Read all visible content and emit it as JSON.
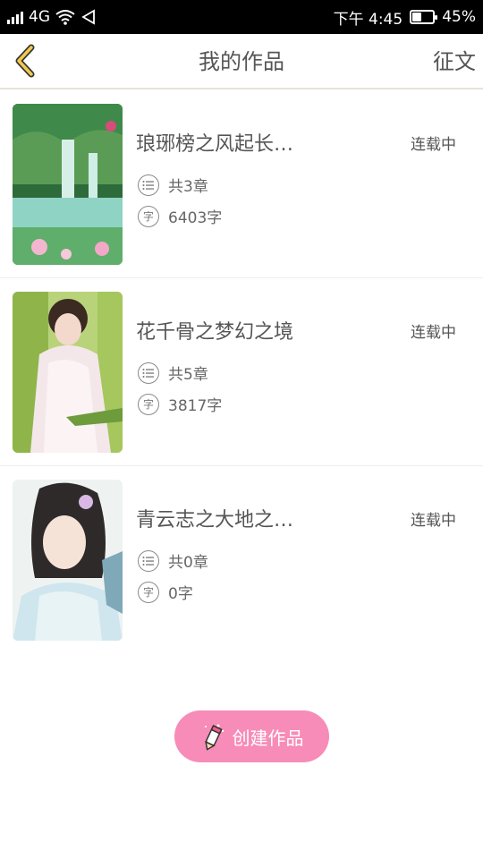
{
  "status_bar": {
    "network": "4G",
    "time": "下午 4:45",
    "battery_percent": 45,
    "battery_label": "45%"
  },
  "header": {
    "title": "我的作品",
    "action": "征文"
  },
  "works": [
    {
      "title": "琅琊榜之风起长…",
      "status": "连载中",
      "chapters": "共3章",
      "words": "6403字"
    },
    {
      "title": "花千骨之梦幻之境",
      "status": "连载中",
      "chapters": "共5章",
      "words": "3817字"
    },
    {
      "title": "青云志之大地之…",
      "status": "连载中",
      "chapters": "共0章",
      "words": "0字"
    }
  ],
  "icons": {
    "chapters_icon": "list-circle-icon",
    "words_icon_char": "字"
  },
  "create_button": {
    "label": "创建作品"
  },
  "colors": {
    "accent": "#f78cb8",
    "back_arrow": "#f2c94c",
    "divider": "#e6e2d8"
  }
}
